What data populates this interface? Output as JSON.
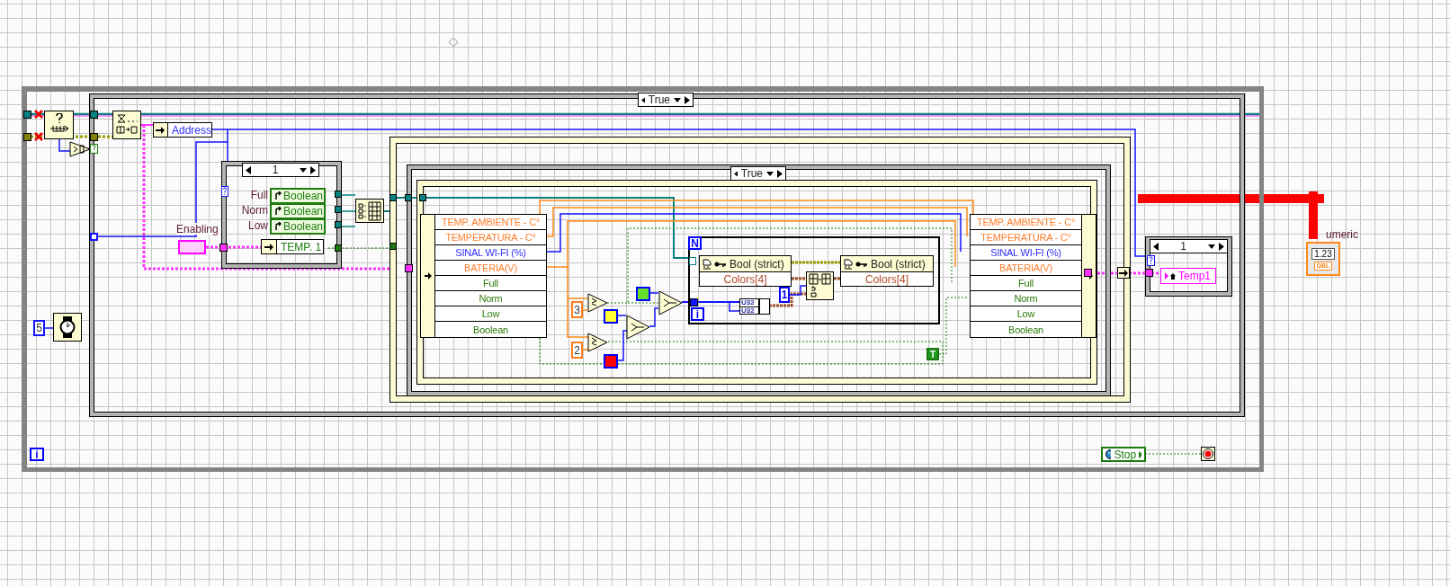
{
  "while_loop": {
    "iteration_terminal": "i",
    "wait_constant": "5",
    "stop_label": "Stop"
  },
  "outer_case": {
    "selector": "True"
  },
  "address_indicator": "Address",
  "mode_case": {
    "selector": "1",
    "constants": [
      {
        "label": "Full",
        "value": "Boolean"
      },
      {
        "label": "Norm",
        "value": "Boolean"
      },
      {
        "label": "Low",
        "value": "Boolean"
      }
    ],
    "temp_local": "TEMP. 1"
  },
  "enabling_control": {
    "label": "Enabling"
  },
  "inner_case": {
    "selector": "True"
  },
  "unbundle_fields": [
    {
      "label": "TEMP. AMBIENTE - C°",
      "kind": "dbl"
    },
    {
      "label": "TEMPERATURA - C°",
      "kind": "dbl"
    },
    {
      "label": "SINAL WI-FI (%)",
      "kind": "int"
    },
    {
      "label": "BATERIA(V)",
      "kind": "dbl"
    },
    {
      "label": "Full",
      "kind": "bool"
    },
    {
      "label": "Norm",
      "kind": "bool"
    },
    {
      "label": "Low",
      "kind": "bool"
    },
    {
      "label": "Boolean",
      "kind": "bool"
    }
  ],
  "comparison_constants": [
    "3",
    "2"
  ],
  "color_constants": [
    {
      "color": "#66e02a"
    },
    {
      "color": "#ffff33"
    },
    {
      "color": "#ff0000"
    }
  ],
  "for_loop": {
    "count_terminal": "N",
    "iteration_terminal": "i",
    "property_nodes": [
      {
        "header": "Bool (strict)",
        "property": "Colors[4]"
      },
      {
        "header": "Bool (strict)",
        "property": "Colors[4]"
      }
    ],
    "conversion_labels": [
      "U32",
      "U32"
    ],
    "index_constant": "1"
  },
  "true_constant": "T",
  "bundle_fields": [
    {
      "label": "TEMP. AMBIENTE - C°",
      "kind": "dbl"
    },
    {
      "label": "TEMPERATURA - C°",
      "kind": "dbl"
    },
    {
      "label": "SINAL WI-FI (%)",
      "kind": "int"
    },
    {
      "label": "BATERIA(V)",
      "kind": "dbl"
    },
    {
      "label": "Full",
      "kind": "bool"
    },
    {
      "label": "Norm",
      "kind": "bool"
    },
    {
      "label": "Low",
      "kind": "bool"
    },
    {
      "label": "Boolean",
      "kind": "bool"
    }
  ],
  "output_case": {
    "selector": "1",
    "local": "Temp1"
  },
  "numeric_indicator": {
    "label": "umeric",
    "value": "1.23",
    "type": "DBL"
  }
}
